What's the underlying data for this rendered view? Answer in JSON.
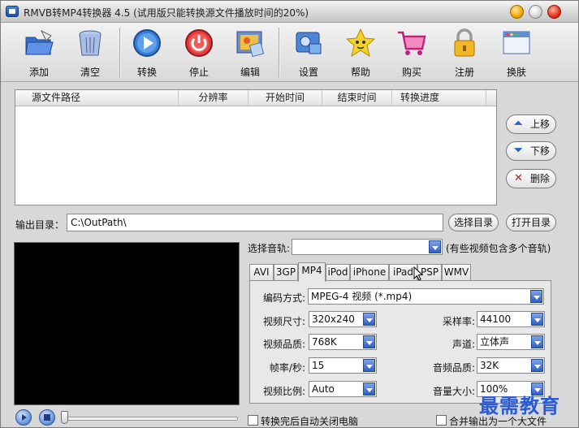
{
  "window": {
    "title": "RMVB转MP4转换器 4.5 (试用版只能转换源文件播放时间的20%)"
  },
  "toolbar": {
    "add": "添加",
    "clear": "清空",
    "convert": "转换",
    "stop": "停止",
    "edit": "编辑",
    "settings": "设置",
    "help": "帮助",
    "buy": "购买",
    "register": "注册",
    "skin": "换肤"
  },
  "filelist": {
    "columns": [
      "源文件路径",
      "分辨率",
      "开始时间",
      "结束时间",
      "转换进度"
    ]
  },
  "side_buttons": {
    "up": "上移",
    "down": "下移",
    "delete": "删除"
  },
  "output": {
    "label": "输出目录：",
    "path": "C:\\OutPath\\",
    "choose": "选择目录",
    "open": "打开目录"
  },
  "audio": {
    "label": "选择音轨:",
    "value": "",
    "hint": "(有些视频包含多个音轨)"
  },
  "tabs": [
    "AVI",
    "3GP",
    "MP4",
    "iPod",
    "iPhone",
    "iPad",
    "PSP",
    "WMV"
  ],
  "active_tab": "MP4",
  "settings": {
    "codec_label": "编码方式:",
    "codec_value": "MPEG-4 视频 (*.mp4)",
    "size_label": "视频尺寸:",
    "size_value": "320x240",
    "quality_label": "视频品质:",
    "quality_value": "768K",
    "fps_label": "帧率/秒:",
    "fps_value": "15",
    "aspect_label": "视频比例:",
    "aspect_value": "Auto",
    "samplerate_label": "采样率:",
    "samplerate_value": "44100",
    "channel_label": "声道:",
    "channel_value": "立体声",
    "audio_quality_label": "音频品质:",
    "audio_quality_value": "32K",
    "volume_label": "音量大小:",
    "volume_value": "100%"
  },
  "bottom": {
    "shutdown_label": "转换完后自动关闭电脑",
    "merge_label": "合并输出为一个大文件"
  },
  "watermark": "最需教育",
  "colors": {
    "accent": "#2f5fc4",
    "preview_bg": "#000000",
    "watermark": "#2a5bd6"
  }
}
